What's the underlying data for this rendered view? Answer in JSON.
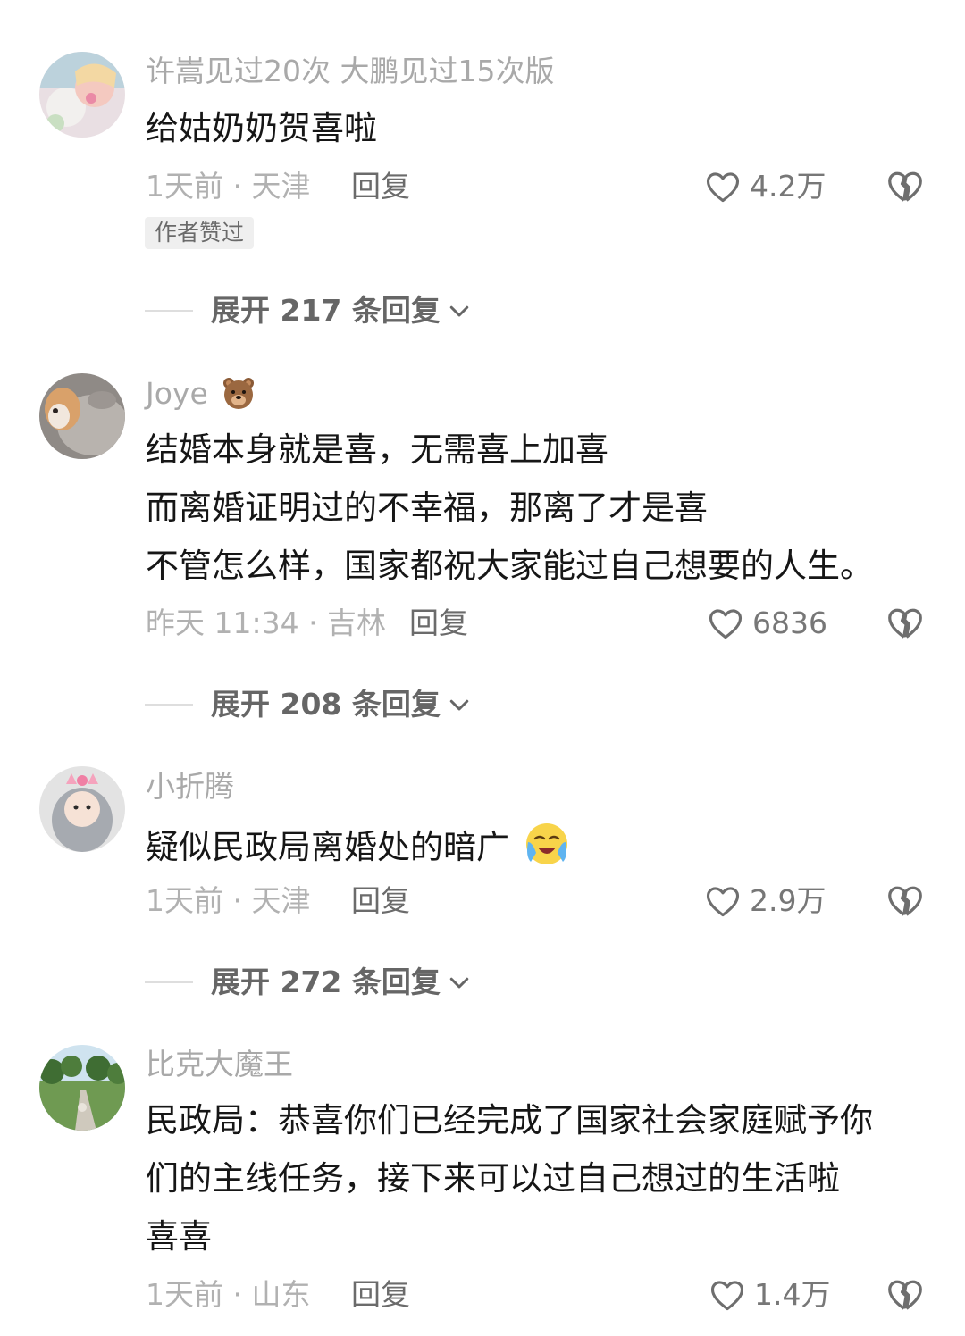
{
  "colors": {
    "text": "#161616",
    "muted": "#b1b1b1",
    "reply": "#6b6b6b",
    "badge_bg": "#efefef"
  },
  "comments": [
    {
      "username": "许嵩见过20次 大鹏见过15次版",
      "lines": [
        "给姑奶奶贺喜啦"
      ],
      "meta": "1天前 · 天津",
      "reply_label": "回复",
      "likes": "4.2万",
      "badge": "作者赞过",
      "expand_label": "展开 217 条回复",
      "like_icon": "heart-outline-icon",
      "dislike_icon": "broken-heart-icon"
    },
    {
      "username": "Joye",
      "username_emoji": "bear-face-emoji",
      "lines": [
        "结婚本身就是喜，无需喜上加喜",
        "而离婚证明过的不幸福，那离了才是喜",
        "不管怎么样，国家都祝大家能过自己想要的人生。"
      ],
      "meta": "昨天 11:34 · 吉林",
      "reply_label": "回复",
      "likes": "6836",
      "expand_label": "展开 208 条回复"
    },
    {
      "username": "小折腾",
      "lines": [
        "疑似民政局离婚处的暗广"
      ],
      "text_emoji": "loudly-crying-face-emoji",
      "meta": "1天前 · 天津",
      "reply_label": "回复",
      "likes": "2.9万",
      "expand_label": "展开 272 条回复"
    },
    {
      "username": "比克大魔王",
      "lines": [
        "民政局：恭喜你们已经完成了国家社会家庭赋予你",
        "们的主线任务，接下来可以过自己想过的生活啦",
        "喜喜"
      ],
      "meta": "1天前 · 山东",
      "reply_label": "回复",
      "likes": "1.4万"
    }
  ]
}
